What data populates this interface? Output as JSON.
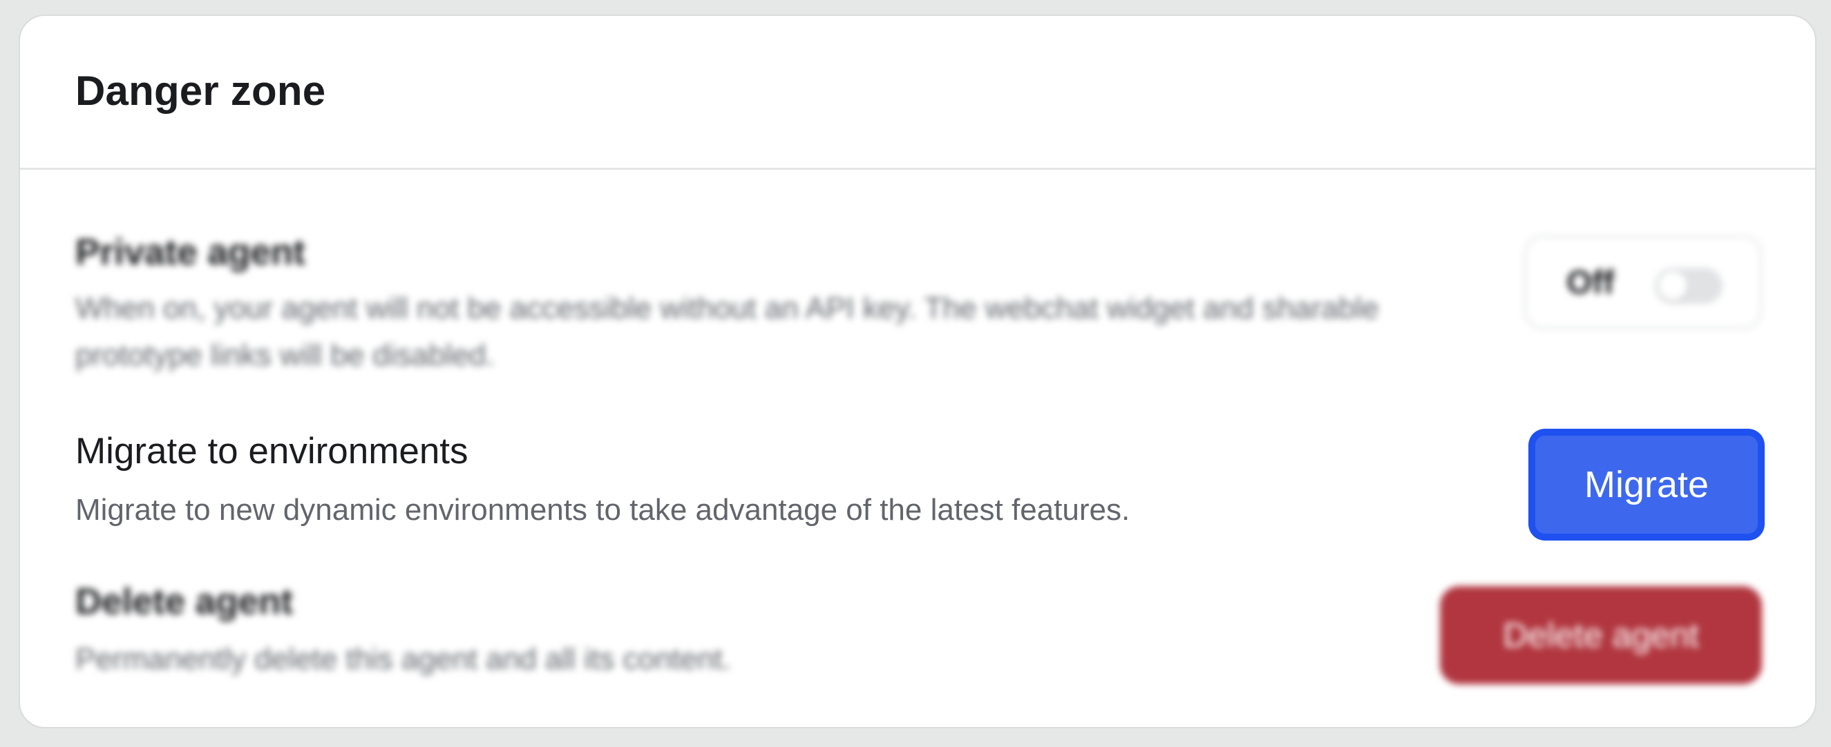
{
  "card": {
    "title": "Danger zone"
  },
  "private_agent": {
    "title": "Private agent",
    "description": "When on, your agent will not be accessible without an API key. The webchat widget and sharable prototype links will be disabled.",
    "toggle_label": "Off",
    "toggle_state": "off"
  },
  "migrate": {
    "title": "Migrate to environments",
    "description": "Migrate to new dynamic environments to take advantage of the latest features.",
    "button_label": "Migrate"
  },
  "delete_agent": {
    "title": "Delete agent",
    "description": "Permanently delete this agent and all its content.",
    "button_label": "Delete agent"
  },
  "colors": {
    "page_background": "#e6e8e7",
    "primary_button": "#3d68ee",
    "primary_button_focus_ring": "#1f51f0",
    "danger_button": "#b1363f"
  }
}
